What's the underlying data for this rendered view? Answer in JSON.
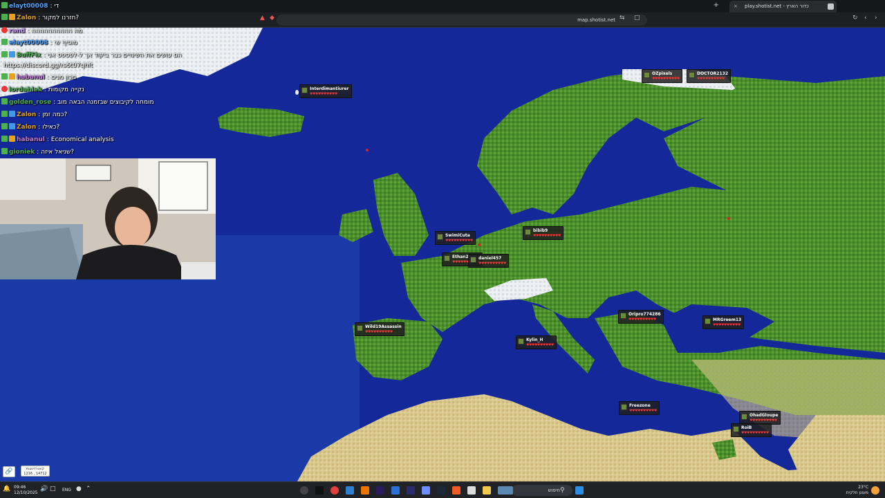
{
  "browser": {
    "tab_title": "play.shotist.net - כדור הארץ",
    "url": "map.shotist.net",
    "new_tab_symbol": "+",
    "close_symbol": "×"
  },
  "chat": {
    "lines": [
      {
        "nick": "elayt00008",
        "text": ": די",
        "nick_color": "#4aa3ff",
        "badges": [
          "k"
        ]
      },
      {
        "nick": "Zalon",
        "text": ": חזרנו למקור?",
        "nick_color": "#e0a020",
        "badges": [
          "k",
          "sub"
        ]
      },
      {
        "nick": "rand",
        "text": ": מה הההההההההה",
        "nick_color": "#c59af0",
        "badges": [
          "red"
        ]
      },
      {
        "nick": "elayt00008",
        "text": ": מוסיף שי",
        "nick_color": "#4aa3ff",
        "badges": [
          "k"
        ]
      },
      {
        "nick": "BuffFix",
        "text": ": הם עושים את השינויים כבר ביקוד אך ל-לפספס אני",
        "nick_color": "#4caf50",
        "badges": [
          "k",
          "mod"
        ]
      },
      {
        "nick": "",
        "text": "https://discord.gg/rs6t07qhft",
        "nick_color": "#ffffff",
        "badges": []
      },
      {
        "nick": "habanul",
        "text": ": מכון מנים",
        "nick_color": "#c07ad9",
        "badges": [
          "k",
          "sub"
        ]
      },
      {
        "nick": "lordahlek",
        "text": ": נקייה מקומות",
        "nick_color": "#4caf50",
        "badges": [
          "red"
        ]
      },
      {
        "nick": "golden_rose",
        "text": ": מומחה לקיבוצים שבזמנה הבאה מוב",
        "nick_color": "#4caf50",
        "badges": [
          "k"
        ]
      },
      {
        "nick": "Zalon",
        "text": ": כמה זמן?",
        "nick_color": "#e0a020",
        "badges": [
          "k",
          "mod"
        ]
      },
      {
        "nick": "Zalon",
        "text": ": כאילו?",
        "nick_color": "#e0a020",
        "badges": [
          "k",
          "mod"
        ]
      },
      {
        "nick": "habanul",
        "text": ": Economical analysis",
        "nick_color": "#c07ad9",
        "badges": [
          "k",
          "sub"
        ]
      },
      {
        "nick": "gioniek",
        "text": ": שניאל איזה?",
        "nick_color": "#4caf50",
        "badges": [
          "k"
        ]
      }
    ]
  },
  "map": {
    "players": [
      {
        "name": "Interdimantiurer",
        "hp": "♥♥♥♥♥♥♥♥♥♥"
      },
      {
        "name": "OZpixels",
        "hp": "♥♥♥♥♥♥♥♥♥♥"
      },
      {
        "name": "DOCTOR2132",
        "hp": "♥♥♥♥♥♥♥♥♥♥"
      },
      {
        "name": "SwimiCuta",
        "hp": "♥♥♥♥♥♥♥♥♥♥"
      },
      {
        "name": "bibib9",
        "hp": "♥♥♥♥♥♥♥♥♥♥"
      },
      {
        "name": "Ethan2",
        "hp": "♥♥♥♥♥♥♥♥♥♥"
      },
      {
        "name": "daniel457",
        "hp": "♥♥♥♥♥♥♥♥♥♥"
      },
      {
        "name": "Wild19Assassin",
        "hp": "♥♥♥♥♥♥♥♥♥♥"
      },
      {
        "name": "Kylin_H",
        "hp": "♥♥♥♥♥♥♥♥♥♥"
      },
      {
        "name": "Oripro774286",
        "hp": "♥♥♥♥♥♥♥♥♥♥"
      },
      {
        "name": "MRGreem13",
        "hp": "♥♥♥♥♥♥♥♥♥♥"
      },
      {
        "name": "Freezone",
        "hp": "♥♥♥♥♥♥♥♥♥♥"
      },
      {
        "name": "OhadGloupe",
        "hp": "♥♥♥♥♥♥♥♥♥♥"
      },
      {
        "name": "RoiB",
        "hp": "♥♥♥♥♥♥♥♥♥♥"
      }
    ],
    "coords_label": "קואורדינטות",
    "coords_value": "1216 , 14712"
  },
  "taskbar": {
    "time": "09:46",
    "date": "12/10/2025",
    "lang": "ENG",
    "search_placeholder": "חיפוש",
    "weather_temp": "23°C",
    "weather_desc": "מעונן חלקית"
  }
}
